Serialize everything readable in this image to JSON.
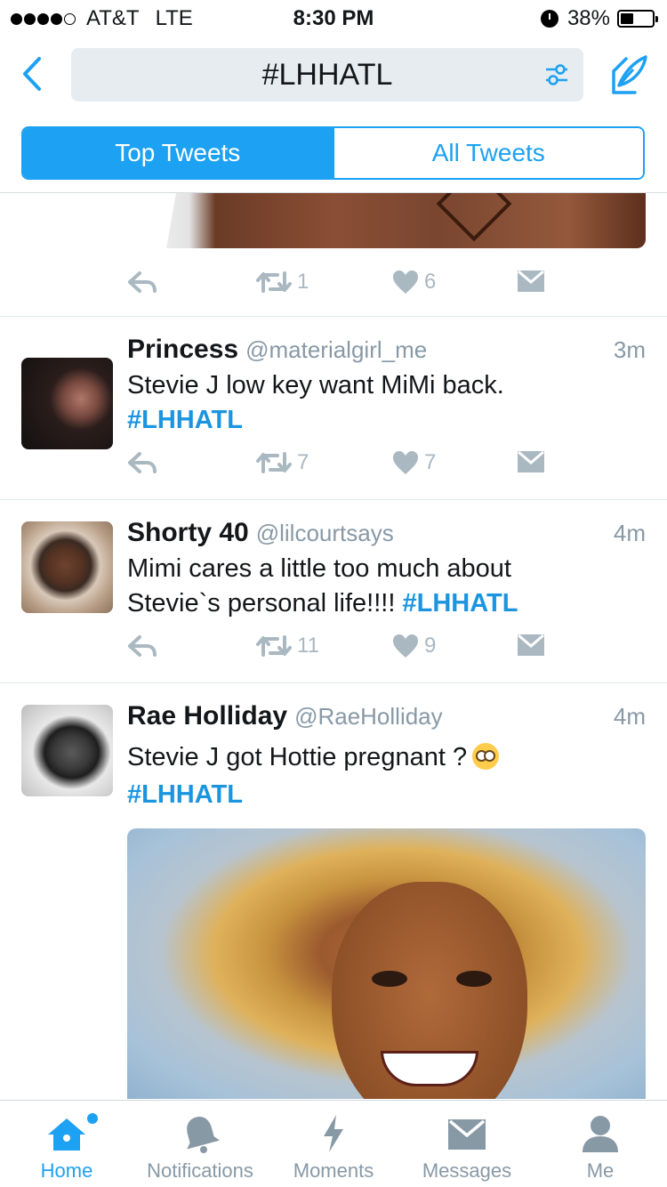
{
  "status_bar": {
    "carrier": "AT&T",
    "network": "LTE",
    "time": "8:30 PM",
    "battery": "38%"
  },
  "nav": {
    "search_query": "#LHHATL",
    "back_icon": "chevron-left-icon",
    "filter_icon": "sliders-icon",
    "compose_icon": "compose-icon"
  },
  "tabs_toggle": {
    "top": "Top Tweets",
    "all": "All Tweets",
    "selected": "Top Tweets"
  },
  "feed": {
    "previous_tweet": {
      "retweets": "1",
      "likes": "6"
    },
    "tweets": [
      {
        "name": "Princess",
        "handle": "@materialgirl_me",
        "time": "3m",
        "text": "Stevie J low key want MiMi back.",
        "hashtag": "#LHHATL",
        "retweets": "7",
        "likes": "7"
      },
      {
        "name": "Shorty 40",
        "handle": "@lilcourtsays",
        "time": "4m",
        "text": "Mimi cares a little too much about Stevie`s personal life!!!!",
        "hashtag": "#LHHATL",
        "retweets": "11",
        "likes": "9"
      },
      {
        "name": "Rae Holliday",
        "handle": "@RaeHolliday",
        "time": "4m",
        "text": "Stevie J got Hottie pregnant ?",
        "emoji": "face-with-rolling-eyes",
        "hashtag": "#LHHATL"
      }
    ]
  },
  "tab_bar": {
    "items": [
      {
        "label": "Home",
        "icon": "home-icon",
        "active": true
      },
      {
        "label": "Notifications",
        "icon": "bell-icon"
      },
      {
        "label": "Moments",
        "icon": "lightning-icon"
      },
      {
        "label": "Messages",
        "icon": "envelope-icon"
      },
      {
        "label": "Me",
        "icon": "person-icon"
      }
    ]
  },
  "colors": {
    "accent": "#1da1f2",
    "hashtag": "#1b95e0",
    "muted": "#8899a6",
    "action_icon": "#aab8c2"
  }
}
